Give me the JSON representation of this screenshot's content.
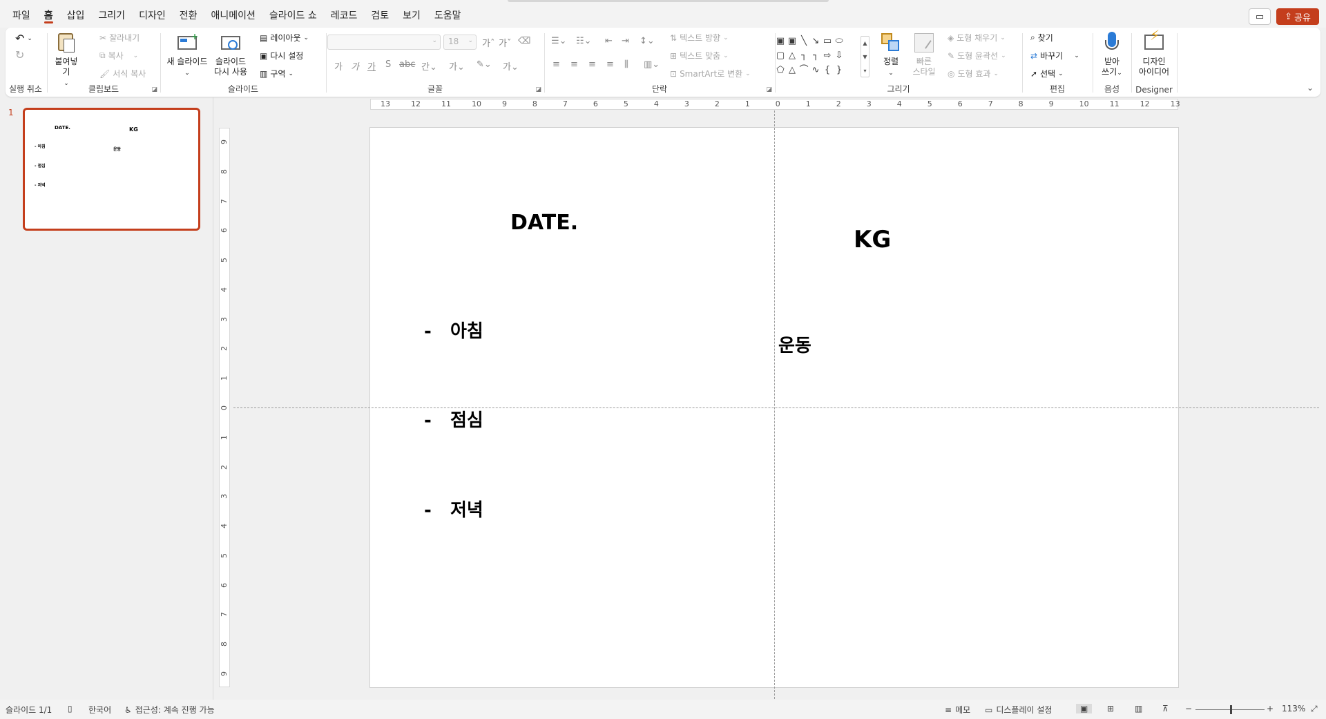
{
  "menu": {
    "tabs": [
      "파일",
      "홈",
      "삽입",
      "그리기",
      "디자인",
      "전환",
      "애니메이션",
      "슬라이드 쇼",
      "레코드",
      "검토",
      "보기",
      "도움말"
    ],
    "active_tab": "홈",
    "share_label": "공유"
  },
  "ribbon": {
    "undo": {
      "label": "실행 취소"
    },
    "clipboard": {
      "label": "클립보드",
      "paste": "붙여넣기",
      "cut": "잘라내기",
      "copy": "복사",
      "format_painter": "서식 복사"
    },
    "slides": {
      "label": "슬라이드",
      "new_slide": "새 슬라이드",
      "reuse_slide_1": "슬라이드",
      "reuse_slide_2": "다시 사용",
      "layout": "레이아웃",
      "reset": "다시 설정",
      "section": "구역"
    },
    "font": {
      "label": "글꼴",
      "font_size": "18"
    },
    "paragraph": {
      "label": "단락",
      "text_direction": "텍스트 방향",
      "align_text": "텍스트 맞춤",
      "smartart": "SmartArt로 변환"
    },
    "drawing": {
      "label": "그리기",
      "arrange": "정렬",
      "quick_styles_1": "빠른",
      "quick_styles_2": "스타일",
      "shape_fill": "도형 채우기",
      "shape_outline": "도형 윤곽선",
      "shape_effects": "도형 효과"
    },
    "editing": {
      "label": "편집",
      "find": "찾기",
      "replace": "바꾸기",
      "select": "선택"
    },
    "voice": {
      "label": "음성",
      "dictate_1": "받아",
      "dictate_2": "쓰기"
    },
    "designer": {
      "label": "Designer",
      "ideas_1": "디자인",
      "ideas_2": "아이디어"
    }
  },
  "thumbnail": {
    "number": "1"
  },
  "slide": {
    "date": "DATE.",
    "kg": "KG",
    "exercise": "운동",
    "morning": "-   아침",
    "lunch": "-   점심",
    "dinner": "-   저녁"
  },
  "rulers": {
    "h_ticks": [
      "13",
      "12",
      "11",
      "10",
      "9",
      "8",
      "7",
      "6",
      "5",
      "4",
      "3",
      "2",
      "1",
      "0",
      "1",
      "2",
      "3",
      "4",
      "5",
      "6",
      "7",
      "8",
      "9",
      "10",
      "11",
      "12",
      "13"
    ],
    "v_ticks": [
      "9",
      "8",
      "7",
      "6",
      "5",
      "4",
      "3",
      "2",
      "1",
      "0",
      "1",
      "2",
      "3",
      "4",
      "5",
      "6",
      "7",
      "8",
      "9"
    ]
  },
  "status": {
    "slide_count": "슬라이드 1/1",
    "language": "한국어",
    "accessibility": "접근성: 계속 진행 가능",
    "notes": "메모",
    "display_settings": "디스플레이 설정",
    "zoom": "113%"
  },
  "colors": {
    "accent": "#c43e1c"
  }
}
